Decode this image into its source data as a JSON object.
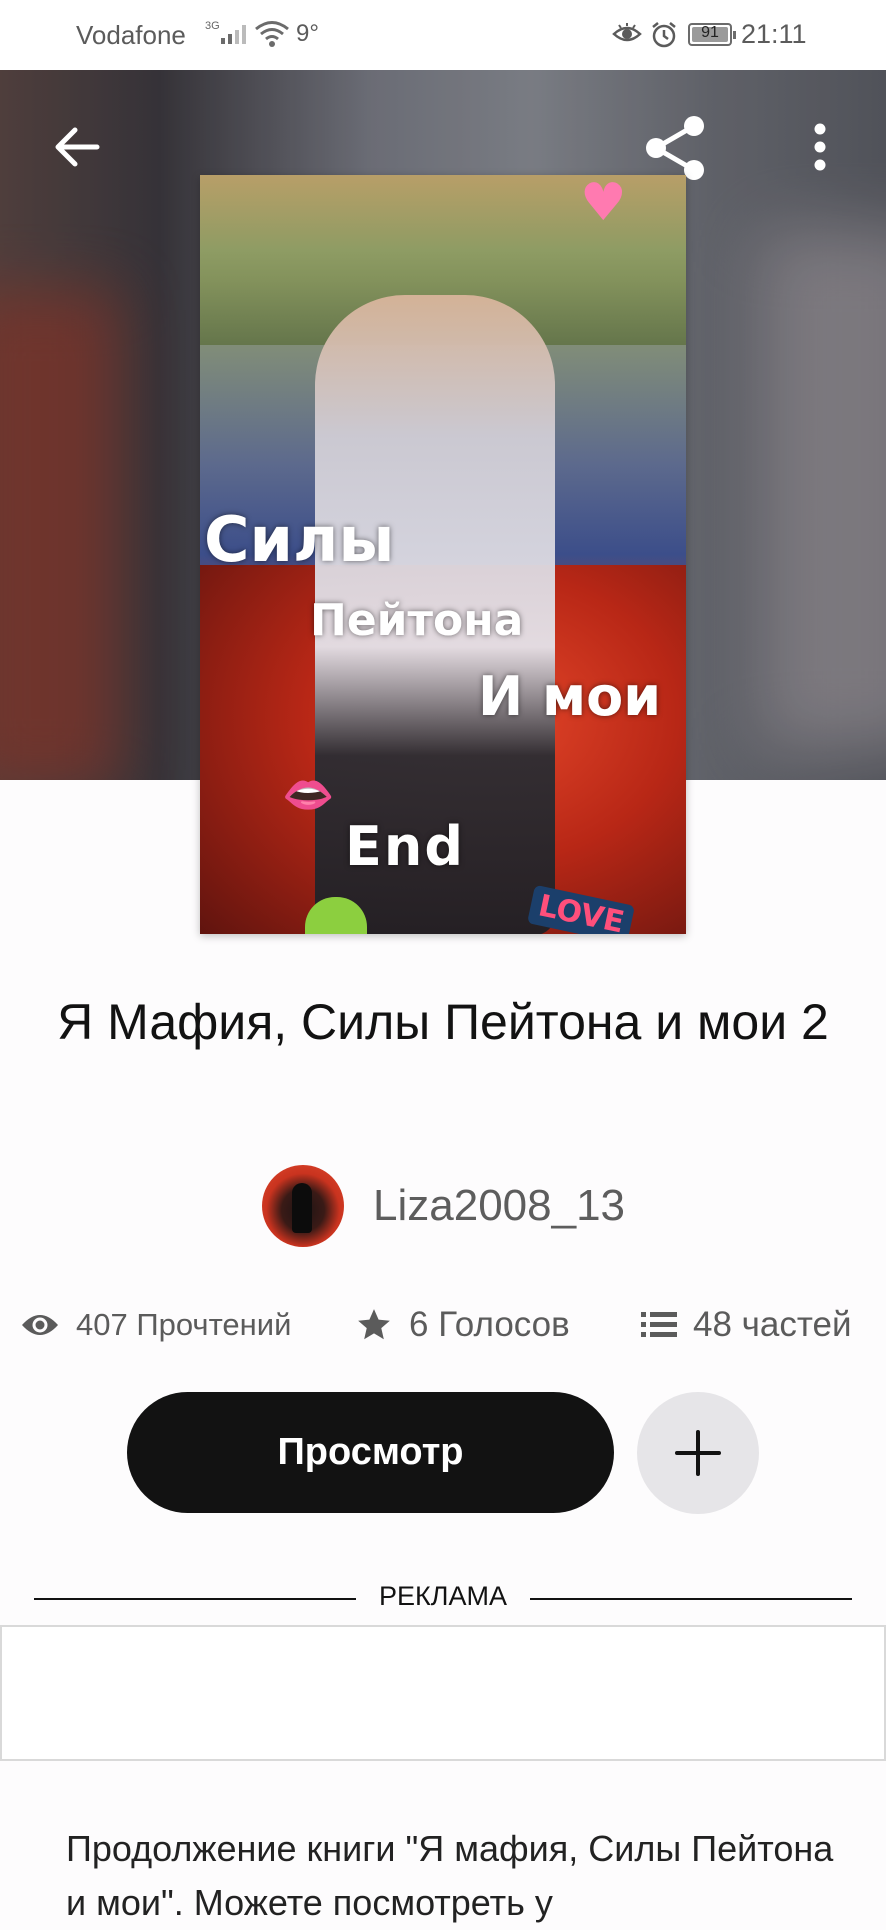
{
  "status_bar": {
    "carrier": "Vodafone",
    "network": "3G",
    "temperature": "9°",
    "battery": "91",
    "time": "21:11"
  },
  "toolbar": {
    "back_icon": "arrow-left-icon",
    "share_icon": "share-icon",
    "more_icon": "more-vertical-icon"
  },
  "cover": {
    "line1": "Силы",
    "line2": "Пейтона",
    "line3": "И мои",
    "line4": "End",
    "sticker": "LOVE"
  },
  "story": {
    "title": "Я Мафия, Силы Пейтона и мои 2",
    "author": "Liza2008_13",
    "reads": "407 Прочтений",
    "votes": "6 Голосов",
    "parts": "48 частей",
    "read_button": "Просмотр",
    "add_icon": "plus-icon"
  },
  "ad": {
    "label": "РЕКЛАМА"
  },
  "description": "Продолжение книги \"Я мафия, Силы Пейтона и мои\". Можете посмотреть у"
}
